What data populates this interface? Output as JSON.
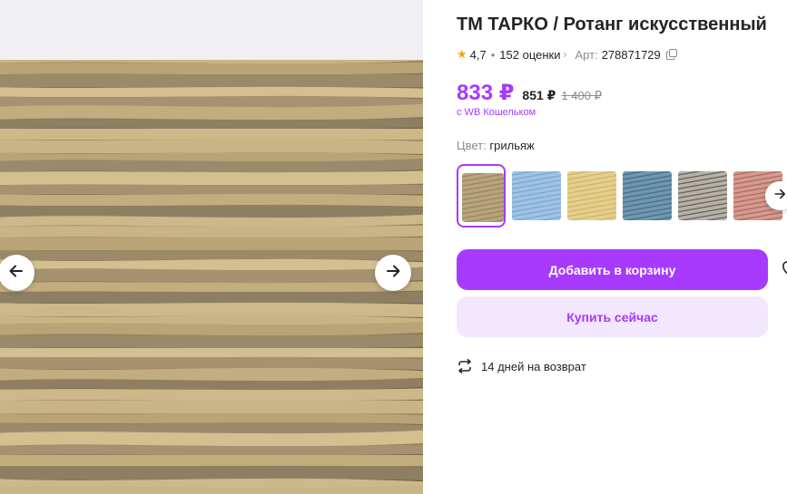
{
  "product": {
    "title": "ТМ ТАРКО / Ротанг искусственный",
    "rating": "4,7",
    "reviews": "152 оценки",
    "article_label": "Арт:",
    "article": "278871729"
  },
  "price": {
    "main": "833 ₽",
    "alt": "851 ₽",
    "old": "1 400 ₽",
    "wallet_note": "с WB Кошельком"
  },
  "color": {
    "label": "Цвет:",
    "value": "грильяж",
    "swatches": [
      {
        "name": "грильяж",
        "colors": [
          "#b9a57c",
          "#8f7c59"
        ]
      },
      {
        "name": "голубой",
        "colors": [
          "#9ec3e6",
          "#6f9fcc"
        ]
      },
      {
        "name": "бежевый",
        "colors": [
          "#e6cf8c",
          "#c9ad62"
        ]
      },
      {
        "name": "сине-серый",
        "colors": [
          "#6f98b0",
          "#3c6078"
        ]
      },
      {
        "name": "серый",
        "colors": [
          "#b7b2a8",
          "#4d4a45"
        ]
      },
      {
        "name": "розовый",
        "colors": [
          "#d69a8f",
          "#9e5e55"
        ]
      }
    ]
  },
  "actions": {
    "add_to_cart": "Добавить в корзину",
    "buy_now": "Купить сейчас"
  },
  "returns": {
    "text": "14 дней на возврат"
  },
  "colors": {
    "accent": "#a73afd",
    "accent_light": "#f3e6ff",
    "star": "#ff9f0a"
  },
  "icons": [
    "arrow-left-icon",
    "arrow-right-icon",
    "star-icon",
    "copy-icon",
    "chevron-right-icon",
    "heart-icon",
    "return-icon"
  ]
}
